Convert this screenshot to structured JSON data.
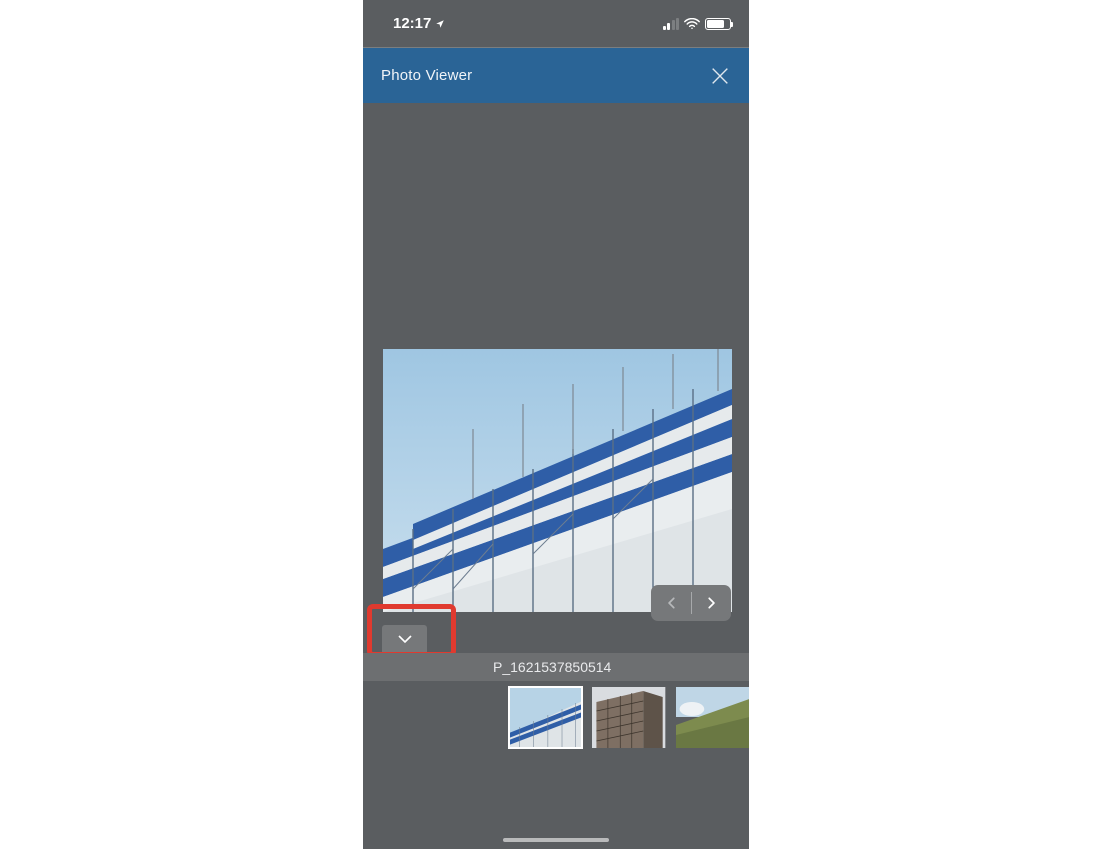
{
  "status": {
    "time": "12:17"
  },
  "header": {
    "title": "Photo Viewer"
  },
  "photo": {
    "filename": "P_1621537850514"
  },
  "thumbs": {
    "selected_index": 0,
    "count": 3
  }
}
